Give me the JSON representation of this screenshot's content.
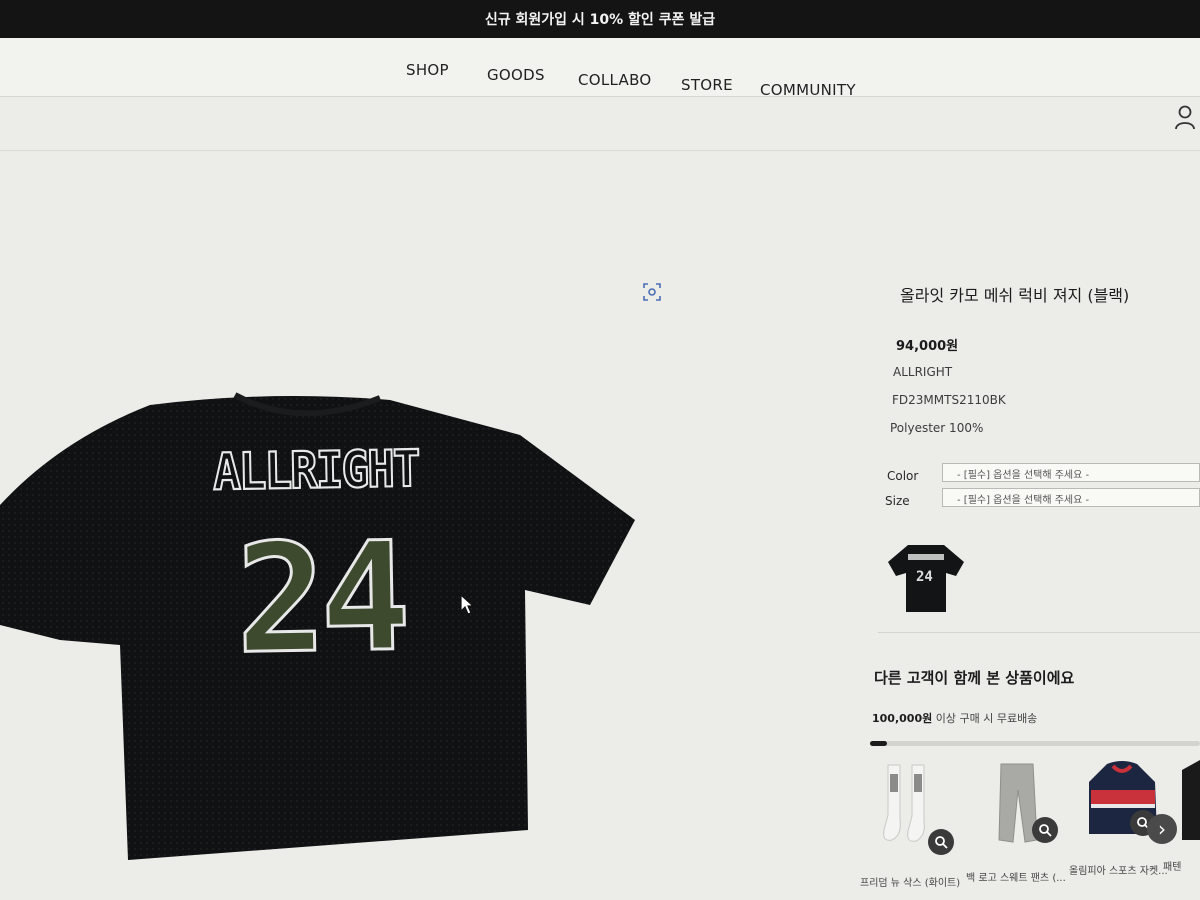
{
  "banner": {
    "text": "신규 회원가입 시 10% 할인 쿠폰 발급"
  },
  "nav": {
    "items": [
      "SHOP",
      "GOODS",
      "COLLABO",
      "STORE",
      "COMMUNITY"
    ]
  },
  "product": {
    "title": "올라잇 카모 메쉬 럭비 져지 (블랙)",
    "price": "94,000원",
    "brand": "ALLRIGHT",
    "code": "FD23MMTS2110BK",
    "material": "Polyester 100%",
    "print_text": "ALLRIGHT",
    "print_number": "24",
    "options": [
      {
        "label": "Color",
        "value": "- [필수] 옵션을 선택해 주세요 -"
      },
      {
        "label": "Size",
        "value": "- [필수] 옵션을 선택해 주세요 -"
      }
    ]
  },
  "related": {
    "title": "다른 고객이 함께 본 상품이에요",
    "shipping_amount": "100,000원",
    "shipping_text": "이상 구매 시 무료배송",
    "progress": 0.05,
    "items": [
      {
        "name": "프리덤 뉴 삭스 (화이트)"
      },
      {
        "name": "백 로고 스웨트 팬츠 (..."
      },
      {
        "name": "올림피아 스포츠 자켓..."
      },
      {
        "name": "패텐"
      }
    ]
  },
  "icons": {
    "user": "user-icon",
    "zoom": "zoom-icon",
    "search": "search-icon",
    "next": "chevron-right-icon",
    "cursor": "mouse-cursor-icon"
  },
  "colors": {
    "banner_bg": "#141414",
    "page_bg": "#ecece8",
    "shirt": "#0f1112",
    "camo": "#3d4a2e"
  }
}
